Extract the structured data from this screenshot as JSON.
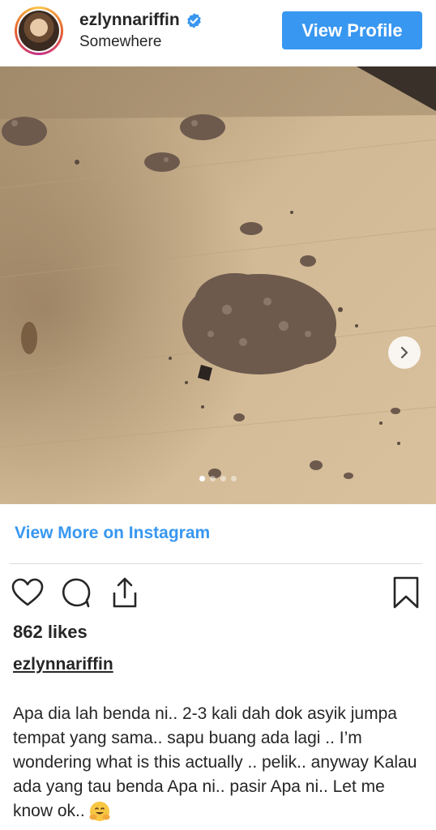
{
  "header": {
    "username": "ezlynnariffin",
    "location": "Somewhere",
    "view_profile_label": "View Profile"
  },
  "post": {
    "carousel": {
      "slide_count": 4,
      "active_slide": 1
    }
  },
  "links": {
    "view_more_label": "View More on Instagram"
  },
  "stats": {
    "likes": "862 likes"
  },
  "caption": {
    "username": "ezlynnariffin",
    "text": "Apa dia lah benda ni.. 2-3 kali dah dok asyik jumpa tempat yang sama.. sapu buang ada lagi .. I’m wondering what is this actually .. pelik.. anyway Kalau ada yang tau benda Apa ni.. pasir Apa ni.. Let me know ok.."
  },
  "icons": {
    "verified": "verified-badge-icon",
    "next": "chevron-right-icon",
    "like": "heart-icon",
    "comment": "comment-icon",
    "share": "share-icon",
    "save": "bookmark-icon",
    "emoji": "hugging-face-emoji"
  },
  "colors": {
    "accent": "#3897f0",
    "text": "#262626",
    "divider": "#dbdbdb"
  }
}
